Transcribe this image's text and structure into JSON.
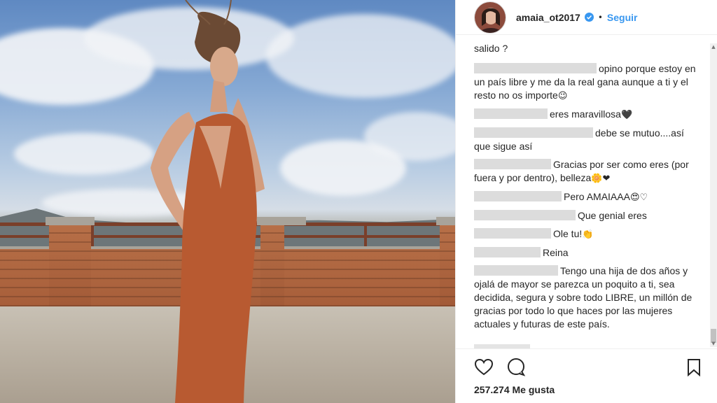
{
  "header": {
    "username": "amaia_ot2017",
    "separator": "•",
    "follow_label": "Seguir"
  },
  "comments": {
    "top_fragment": "salido ?",
    "items": [
      {
        "user_width": 175,
        "text": "opino porque estoy en un país libre y me da la real gana aunque a ti y el resto no os importe",
        "emoji": "😉"
      },
      {
        "user_width": 105,
        "text": "eres maravillosa",
        "emoji": "🖤"
      },
      {
        "user_width": 170,
        "text": "debe se mutuo....así que sigue así",
        "emoji": ""
      },
      {
        "user_width": 110,
        "text": "Gracias por ser como eres (por fuera y por dentro), belleza",
        "emoji": "🌼❤"
      },
      {
        "user_width": 125,
        "text": "Pero AMAIAAA",
        "emoji": "😍♡"
      },
      {
        "user_width": 145,
        "text": "Que genial eres",
        "emoji": ""
      },
      {
        "user_width": 110,
        "text": "Ole tu!",
        "emoji": "👏"
      },
      {
        "user_width": 95,
        "text": "Reina",
        "emoji": ""
      },
      {
        "user_width": 120,
        "text": "Tengo una hija de dos años y ojalá de mayor se parezca un poquito a ti, sea decidida, segura y sobre todo LIBRE, un millón de gracias por todo lo que haces por las mujeres actuales y futuras de este país.",
        "emoji": ""
      }
    ]
  },
  "actions": {
    "like_icon": "heart-outline-icon",
    "comment_icon": "speech-bubble-icon",
    "save_icon": "bookmark-icon",
    "likes_count": "257.274 Me gusta"
  },
  "colors": {
    "accent": "#3897f0",
    "dress": "#b85a31"
  }
}
